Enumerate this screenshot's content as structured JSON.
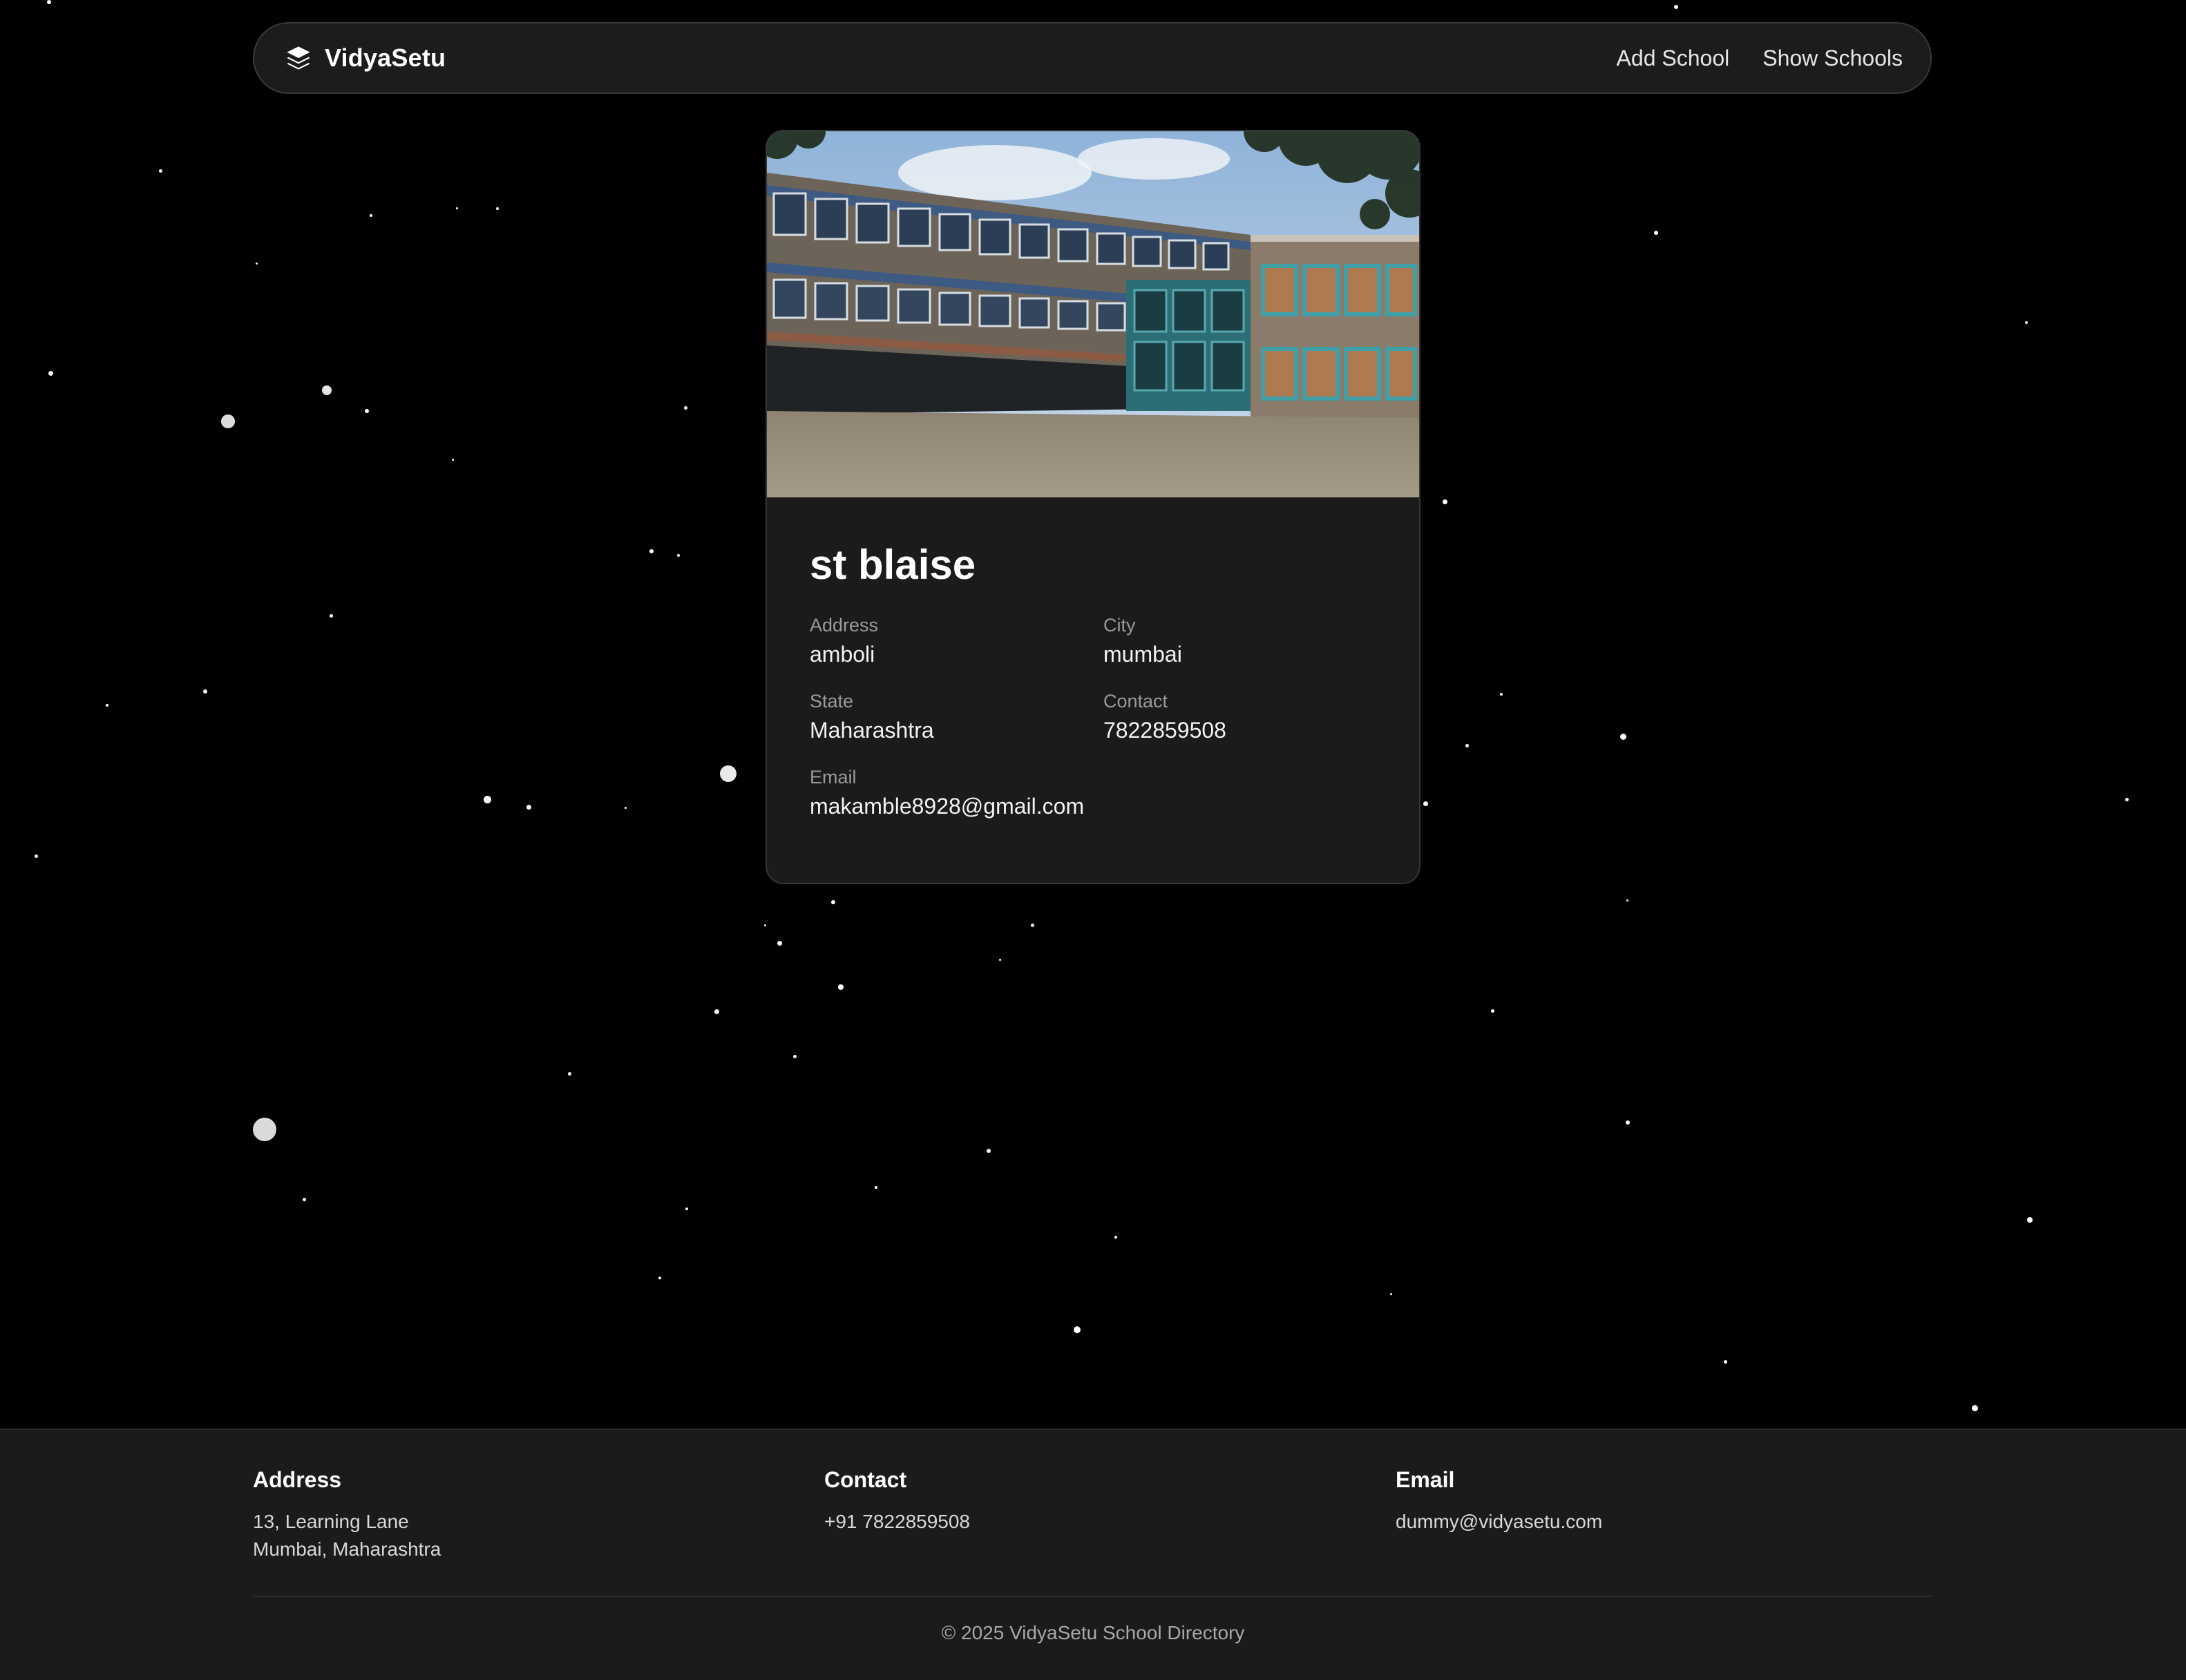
{
  "navbar": {
    "brand_name": "VidyaSetu",
    "links": [
      "Add School",
      "Show Schools"
    ]
  },
  "school": {
    "name": "st blaise",
    "image": "school-building-photo",
    "address_label": "Address",
    "address": "amboli",
    "city_label": "City",
    "city": "mumbai",
    "state_label": "State",
    "state": "Maharashtra",
    "contact_label": "Contact",
    "contact": "7822859508",
    "email_label": "Email",
    "email": "makamble8928@gmail.com"
  },
  "footer": {
    "address_heading": "Address",
    "address_line1": "13, Learning Lane",
    "address_line2": "Mumbai, Maharashtra",
    "contact_heading": "Contact",
    "contact_value": "+91 7822859508",
    "email_heading": "Email",
    "email_value": "dummy@vidyasetu.com",
    "copyright": "© 2025 VidyaSetu School Directory"
  },
  "colors": {
    "background": "#000000",
    "surface": "#1b1b1b",
    "muted_text": "#9a9a9a"
  }
}
